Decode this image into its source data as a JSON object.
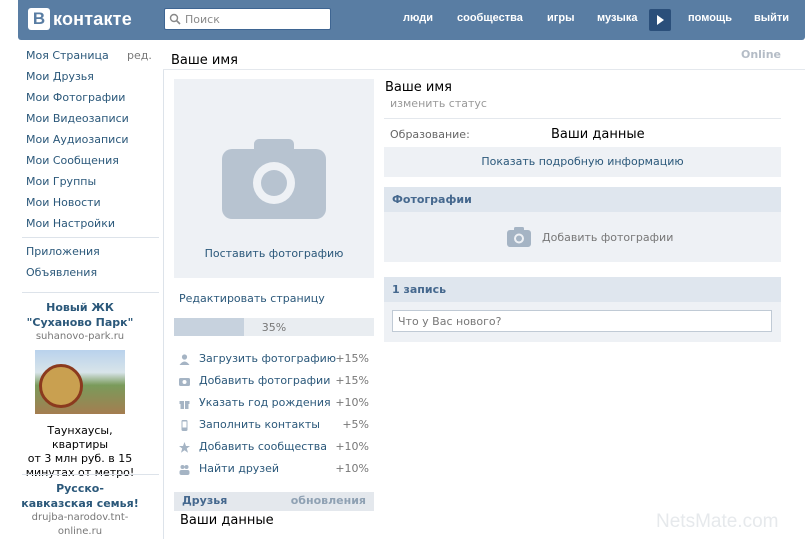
{
  "header": {
    "logo_letter": "B",
    "logo_text": "контакте",
    "search_placeholder": "Поиск",
    "nav": [
      "люди",
      "сообщества",
      "игры",
      "музыка",
      "помощь",
      "выйти"
    ]
  },
  "sidebar": {
    "items": [
      {
        "label": "Моя Страница",
        "edit": "ред."
      },
      {
        "label": "Мои Друзья"
      },
      {
        "label": "Мои Фотографии"
      },
      {
        "label": "Мои Видеозаписи"
      },
      {
        "label": "Мои Аудиозаписи"
      },
      {
        "label": "Мои Сообщения"
      },
      {
        "label": "Мои Группы"
      },
      {
        "label": "Мои Новости"
      },
      {
        "label": "Мои Настройки"
      }
    ],
    "extra": [
      "Приложения",
      "Объявления"
    ]
  },
  "ads": [
    {
      "title1": "Новый ЖК",
      "title2": "\"Суханово Парк\"",
      "url": "suhanovo-park.ru",
      "text1": "Таунхаусы, квартиры",
      "text2": "от 3 млн руб. в 15",
      "text3": "минутах от метро!"
    },
    {
      "title1": "Русско-",
      "title2": "кавказская семья!",
      "url1": "drujba-narodov.tnt-",
      "url2": "online.ru"
    }
  ],
  "profile": {
    "online": "Online",
    "name_title": "Ваше имя",
    "photo_caption": "Поставить фотографию",
    "edit_page": "Редактировать страницу",
    "progress": {
      "percent_label": "35%",
      "fraction": 0.35
    },
    "tasks": [
      {
        "label": "Загрузить фотографию",
        "pct": "+15%",
        "icon": "user-icon"
      },
      {
        "label": "Добавить фотографии",
        "pct": "+15%",
        "icon": "camera-icon"
      },
      {
        "label": "Указать год рождения",
        "pct": "+10%",
        "icon": "gift-icon"
      },
      {
        "label": "Заполнить контакты",
        "pct": "+5%",
        "icon": "phone-icon"
      },
      {
        "label": "Добавить сообщества",
        "pct": "+10%",
        "icon": "star-icon"
      },
      {
        "label": "Найти друзей",
        "pct": "+10%",
        "icon": "friends-icon"
      }
    ],
    "friends": {
      "title": "Друзья",
      "updates": "обновления",
      "name": "Ваши данные"
    }
  },
  "info": {
    "name": "Ваше имя",
    "status": "изменить статус",
    "education_label": "Образование:",
    "education_value": "Ваши данные",
    "more_info": "Показать подробную информацию",
    "photos_header": "Фотографии",
    "add_photos": "Добавить фотографии",
    "wall_header": "1 запись",
    "wall_placeholder": "Что у Вас нового?"
  },
  "watermark": "NetsMate.com",
  "colors": {
    "header": "#597da3",
    "link": "#2b587a",
    "box_bg": "#eef1f5",
    "box_header": "#dfe6ee"
  }
}
